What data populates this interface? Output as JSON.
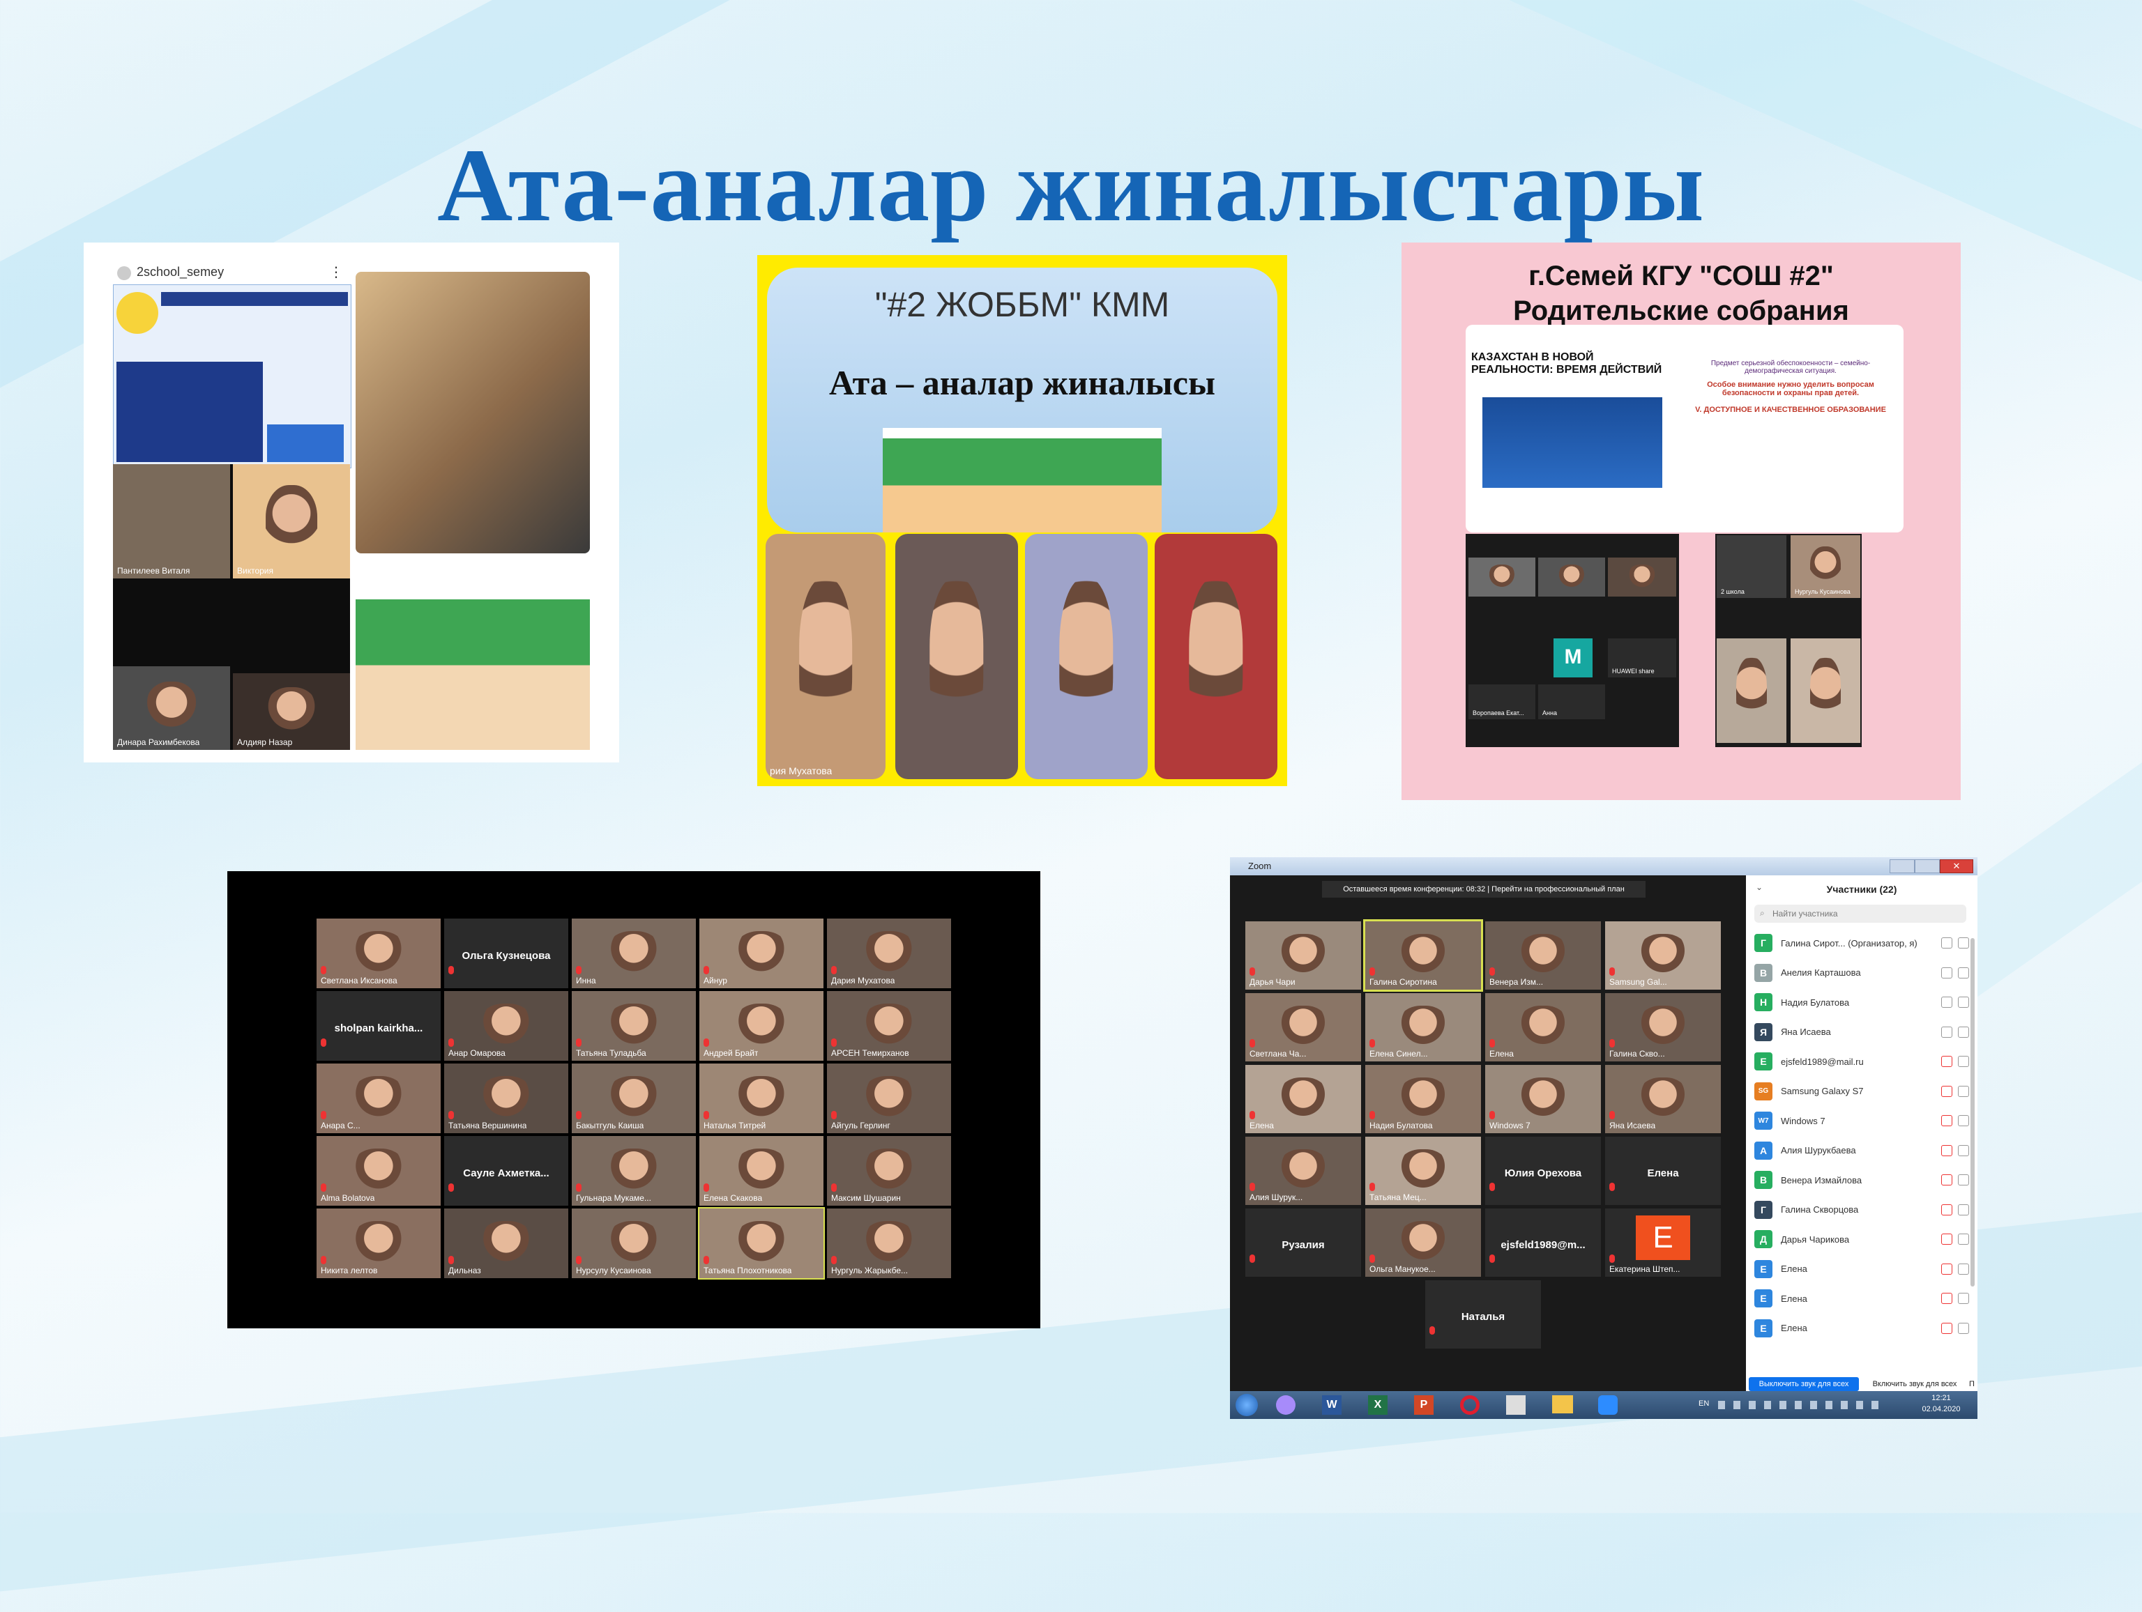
{
  "slide_title": "Ата-аналар жиналыстары",
  "panel1": {
    "account": "2school_semey",
    "menu": "⋮",
    "names": [
      "Пантилеев Виталя",
      "Виктория",
      "Динара Рахимбекова",
      "Алдияр Назар"
    ]
  },
  "panel2": {
    "heading": "\"#2 ЖОББМ\" КММ",
    "subheading": "Ата – аналар жиналысы",
    "caption": "рия Мухатова"
  },
  "panel3": {
    "title_line1": "г.Семей КГУ \"СОШ #2\"",
    "title_line2": "Родительские собрания",
    "slide_heading": "КАЗАХСТАН В НОВОЙ РЕАЛЬНОСТИ: ВРЕМЯ ДЕЙСТВИЙ",
    "slide_text1": "Предмет серьезной обеспокоенности – семейно-демографическая ситуация.",
    "slide_text2": "Особое внимание нужно уделить вопросам безопасности и охраны прав детей.",
    "slide_text3": "V. ДОСТУПНОЕ И КАЧЕСТВЕННОЕ ОБРАЗОВАНИЕ",
    "grid_names": [
      "Воропаева Екат...",
      "Анна",
      "HUAWEI share"
    ],
    "m_letter": "M",
    "right_names": [
      "Нургуль Кусаинова",
      "2 школа"
    ]
  },
  "panel4": {
    "tiles": [
      {
        "name": "Светлана Иксанова",
        "type": "video"
      },
      {
        "name": "Ольга Кузнецова",
        "type": "text"
      },
      {
        "name": "Инна",
        "type": "video"
      },
      {
        "name": "Айнур",
        "type": "video"
      },
      {
        "name": "Дария Мухатова",
        "type": "video"
      },
      {
        "name": "sholpan kairkha...",
        "type": "text"
      },
      {
        "name": "Анар Омарова",
        "type": "video"
      },
      {
        "name": "Татьяна Туладьба",
        "type": "video"
      },
      {
        "name": "Андрей Брайт",
        "type": "video"
      },
      {
        "name": "АРСЕН Темирханов",
        "type": "video"
      },
      {
        "name": "Анара С...",
        "type": "video"
      },
      {
        "name": "Татьяна Вершинина",
        "type": "video"
      },
      {
        "name": "Бакытгуль Каиша",
        "type": "video"
      },
      {
        "name": "Наталья Титрей",
        "type": "video"
      },
      {
        "name": "Айгуль Герлинг",
        "type": "video"
      },
      {
        "name": "Alma Bolatova",
        "type": "video"
      },
      {
        "name": "Сауле Ахметка...",
        "type": "text"
      },
      {
        "name": "Гульнара Мукаме...",
        "type": "video"
      },
      {
        "name": "Елена Скакова",
        "type": "video"
      },
      {
        "name": "Максим Шушарин",
        "type": "video"
      },
      {
        "name": "Никита лелтов",
        "type": "video"
      },
      {
        "name": "Дильназ",
        "type": "video"
      },
      {
        "name": "Нурсулу Кусаинова",
        "type": "video"
      },
      {
        "name": "Татьяна Плохотникова",
        "type": "video"
      },
      {
        "name": "Нургуль Жарыкбе...",
        "type": "video"
      }
    ]
  },
  "zoom": {
    "window_title": "Zoom",
    "banner": "Оставшееся время конференции: 08:32 | Перейти на профессиональный план",
    "tiles": [
      {
        "name": "Дарья Чари",
        "type": "video"
      },
      {
        "name": "Галина Сиротина",
        "type": "video"
      },
      {
        "name": "Венера Изм...",
        "type": "video"
      },
      {
        "name": "Samsung Gal...",
        "type": "video"
      },
      {
        "name": "Светлана Ча...",
        "type": "video"
      },
      {
        "name": "Елена Синел...",
        "type": "video"
      },
      {
        "name": "Елена",
        "type": "video"
      },
      {
        "name": "Галина Скво...",
        "type": "video"
      },
      {
        "name": "Елена",
        "type": "video"
      },
      {
        "name": "Надия Булатова",
        "type": "video"
      },
      {
        "name": "Windows 7",
        "type": "video"
      },
      {
        "name": "Яна Исаева",
        "type": "video"
      },
      {
        "name": "Алия Шурук...",
        "type": "video"
      },
      {
        "name": "Татьяна Мец...",
        "type": "video"
      },
      {
        "name": "Юлия Орехова",
        "type": "text"
      },
      {
        "name": "Елена",
        "type": "text"
      },
      {
        "name": "Рузалия",
        "type": "text"
      },
      {
        "name": "Ольга Манукое...",
        "type": "video"
      },
      {
        "name": "ejsfeld1989@m...",
        "type": "text"
      },
      {
        "name": "Екатерина Штеп...",
        "type": "letter",
        "letter": "E"
      },
      {
        "name": "Наталья",
        "type": "text"
      }
    ],
    "participants_title": "Участники (22)",
    "search_placeholder": "Найти участника",
    "participants": [
      {
        "initial": "Г",
        "name": "Галина Сирот... (Организатор, я)",
        "color": "#27ae60",
        "muted": false
      },
      {
        "initial": "В",
        "name": "Анелия Карташова",
        "color": "#95a5a6",
        "muted": false
      },
      {
        "initial": "Н",
        "name": "Надия Булатова",
        "color": "#27ae60",
        "muted": false
      },
      {
        "initial": "Я",
        "name": "Яна Исаева",
        "color": "#34495e",
        "muted": false
      },
      {
        "initial": "Е",
        "name": "ejsfeld1989@mail.ru",
        "color": "#27ae60",
        "muted": true
      },
      {
        "initial": "SG",
        "name": "Samsung Galaxy S7",
        "color": "#e67e22",
        "muted": true
      },
      {
        "initial": "W7",
        "name": "Windows 7",
        "color": "#2e86de",
        "muted": true
      },
      {
        "initial": "А",
        "name": "Алия Шурукбаева",
        "color": "#2e86de",
        "muted": true
      },
      {
        "initial": "В",
        "name": "Венера Измайлова",
        "color": "#27ae60",
        "muted": true
      },
      {
        "initial": "Г",
        "name": "Галина Скворцова",
        "color": "#34495e",
        "muted": true
      },
      {
        "initial": "Д",
        "name": "Дарья Чарикова",
        "color": "#27ae60",
        "muted": true
      },
      {
        "initial": "Е",
        "name": "Елена",
        "color": "#2e86de",
        "muted": true
      },
      {
        "initial": "Е",
        "name": "Елена",
        "color": "#2e86de",
        "muted": true
      },
      {
        "initial": "Е",
        "name": "Елена",
        "color": "#2e86de",
        "muted": true
      }
    ],
    "btn_mute_all": "Выключить звук для всех",
    "btn_unmute_all": "Включить звук для всех",
    "btn_more": "П",
    "tray_lang": "EN",
    "clock_time": "12:21",
    "clock_date": "02.04.2020"
  }
}
